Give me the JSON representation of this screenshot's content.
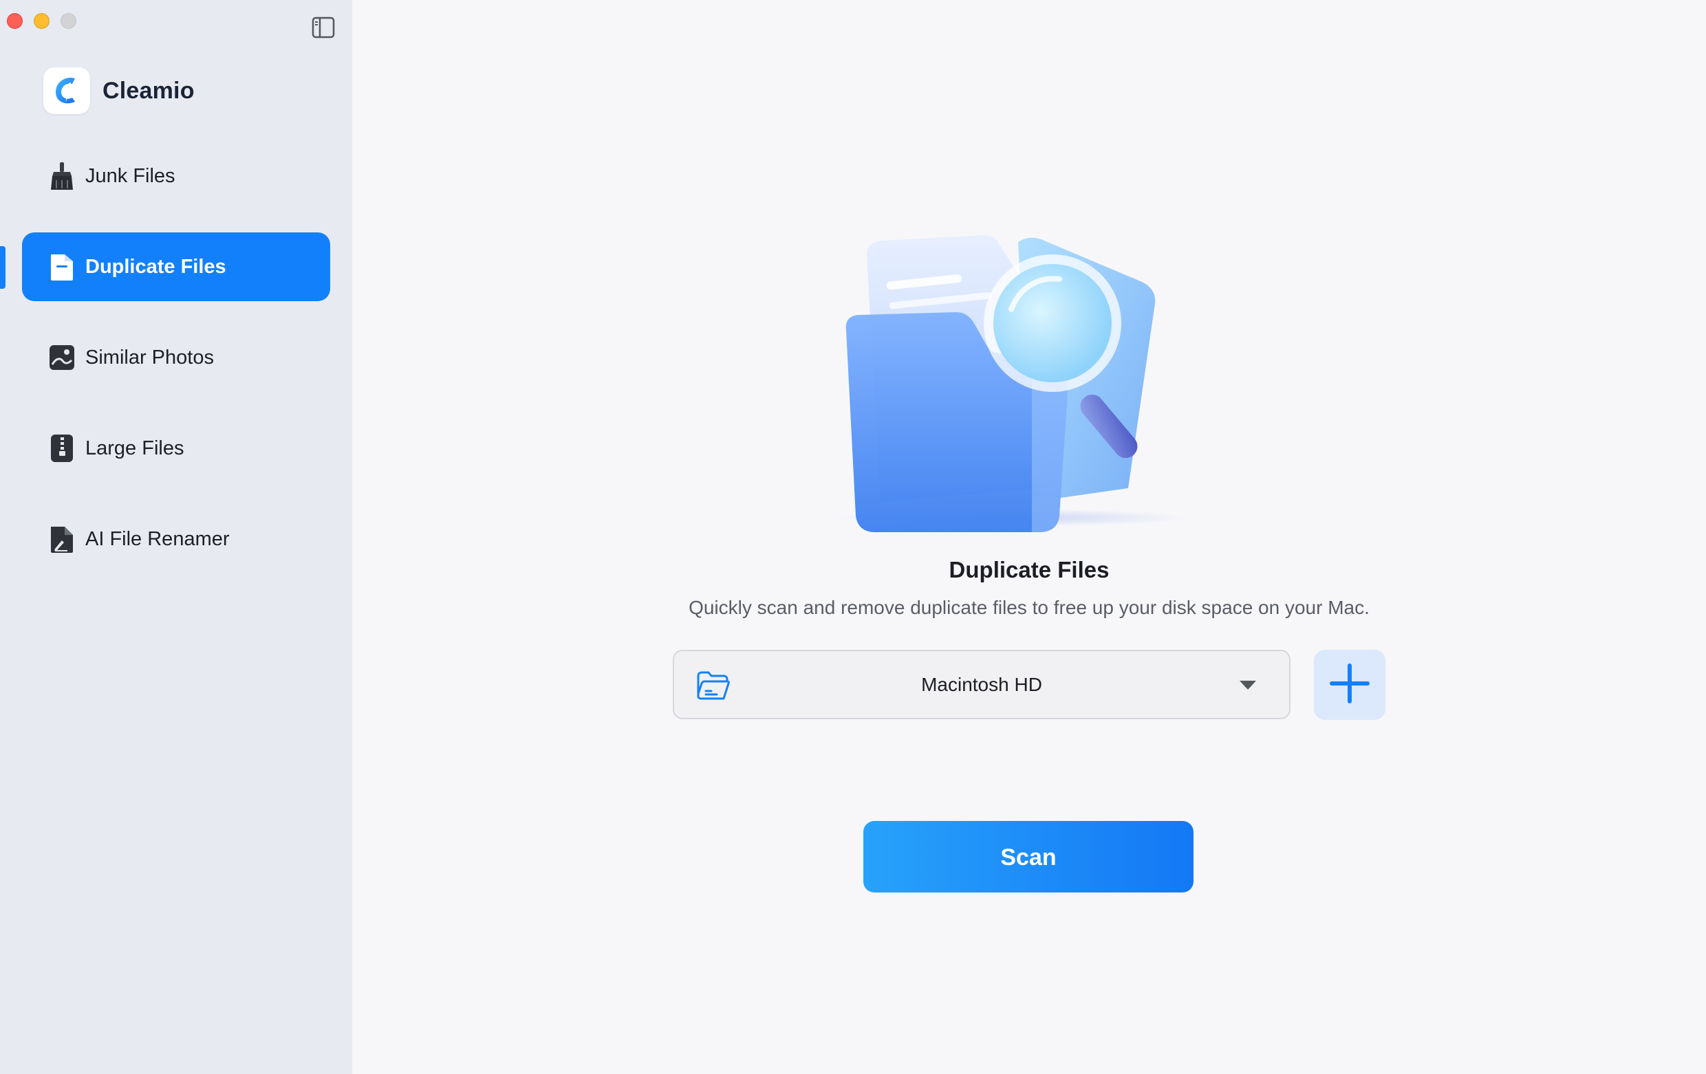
{
  "app": {
    "name": "Cleamio"
  },
  "sidebar": {
    "items": [
      {
        "label": "Junk Files",
        "icon": "broom-icon",
        "active": false
      },
      {
        "label": "Duplicate Files",
        "icon": "document-icon",
        "active": true
      },
      {
        "label": "Similar Photos",
        "icon": "photo-icon",
        "active": false
      },
      {
        "label": "Large Files",
        "icon": "zip-file-icon",
        "active": false
      },
      {
        "label": "AI File Renamer",
        "icon": "rename-file-icon",
        "active": false
      }
    ]
  },
  "main": {
    "title": "Duplicate Files",
    "subtitle": "Quickly scan and remove duplicate files to free up your disk space on your Mac.",
    "location_select": {
      "value": "Macintosh HD",
      "icon": "folder-open-icon"
    },
    "add_button_icon": "plus-icon",
    "scan_label": "Scan"
  },
  "colors": {
    "accent": "#1380fb",
    "sidebar_bg": "#e8eaf2",
    "main_bg": "#f7f7fa",
    "add_button_bg": "#dce8fb"
  }
}
